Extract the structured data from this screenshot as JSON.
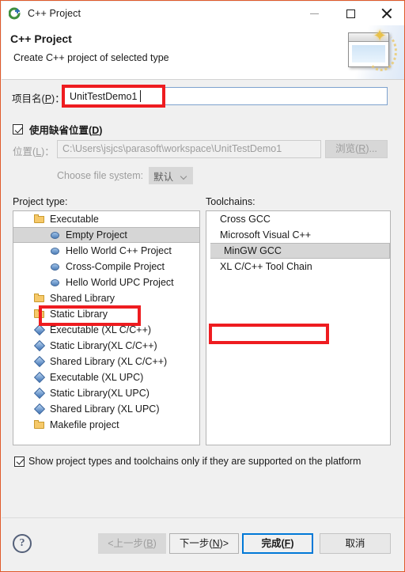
{
  "window": {
    "title": "C++ Project",
    "icon": "cpp-project-icon",
    "minimize_label": "—",
    "maximize_label": "□",
    "close_label": "✕"
  },
  "header": {
    "title": "C++ Project",
    "subtitle": "Create C++ project of selected type",
    "banner_icon": "wizard-window-sparkle-icon",
    "sparkle_glyph": "✦"
  },
  "form": {
    "project_name_label": "项目名(P)：",
    "project_name_label_plain": "项目名",
    "project_name_mnemonic": "P",
    "project_name_value": "UnitTestDemo1",
    "use_default_location_label": "使用缺省位置(D)",
    "use_default_location_plain": "使用缺省位置",
    "use_default_location_mnemonic": "D",
    "use_default_location_checked": true,
    "location_label_plain": "位置",
    "location_mnemonic": "L",
    "location_label": "位置(L)：",
    "location_value": "C:\\Users\\jsjcs\\parasoft\\workspace\\UnitTestDemo1",
    "browse_button": "浏览(R)...",
    "browse_plain": "浏览",
    "browse_mnemonic": "R",
    "choose_fs_label": "Choose file s",
    "choose_fs_mnemonic": "y",
    "choose_fs_label_tail": "stem:",
    "choose_fs_value": "默认"
  },
  "project_type": {
    "label": "Project type:",
    "items": [
      {
        "text": "Executable",
        "icon": "folder-icon",
        "indent": 0,
        "selected": false
      },
      {
        "text": "Empty Project",
        "icon": "ball-icon",
        "indent": 1,
        "selected": true
      },
      {
        "text": "Hello World C++ Project",
        "icon": "ball-icon",
        "indent": 1,
        "selected": false
      },
      {
        "text": "Cross-Compile Project",
        "icon": "ball-icon",
        "indent": 1,
        "selected": false
      },
      {
        "text": "Hello World UPC Project",
        "icon": "ball-icon",
        "indent": 1,
        "selected": false
      },
      {
        "text": "Shared Library",
        "icon": "folder-icon",
        "indent": 0,
        "selected": false
      },
      {
        "text": "Static Library",
        "icon": "folder-icon",
        "indent": 0,
        "selected": false
      },
      {
        "text": "Executable (XL C/C++)",
        "icon": "diamond-icon",
        "indent": 0,
        "selected": false
      },
      {
        "text": "Static Library(XL C/C++)",
        "icon": "diamond-icon",
        "indent": 0,
        "selected": false
      },
      {
        "text": "Shared Library (XL C/C++)",
        "icon": "diamond-icon",
        "indent": 0,
        "selected": false
      },
      {
        "text": "Executable (XL UPC)",
        "icon": "diamond-icon",
        "indent": 0,
        "selected": false
      },
      {
        "text": "Static Library(XL UPC)",
        "icon": "diamond-icon",
        "indent": 0,
        "selected": false
      },
      {
        "text": "Shared Library (XL UPC)",
        "icon": "diamond-icon",
        "indent": 0,
        "selected": false
      },
      {
        "text": "Makefile project",
        "icon": "folder-icon",
        "indent": 0,
        "selected": false
      }
    ]
  },
  "toolchains": {
    "label": "Toolchains:",
    "items": [
      {
        "text": "Cross GCC",
        "selected": false
      },
      {
        "text": "Microsoft Visual C++",
        "selected": false
      },
      {
        "text": "MinGW GCC",
        "selected": true
      },
      {
        "text": "XL C/C++ Tool Chain",
        "selected": false
      }
    ]
  },
  "options": {
    "show_supported_label": "Show project types and toolchains only if they are supported on the platform",
    "show_supported_checked": true
  },
  "footer": {
    "help_glyph": "?",
    "back_button": "<上一步(B)",
    "back_plain_pre": "<上一步(",
    "back_mnemonic": "B",
    "next_button": "下一步(N)>",
    "next_plain_pre": "下一步(",
    "next_mnemonic": "N",
    "finish_button": "完成(F)",
    "finish_plain_pre": "完成(",
    "finish_mnemonic": "F",
    "cancel_button": "取消"
  },
  "annotations": {
    "color": "#ee1c20",
    "boxes": [
      "project-name-field",
      "empty-project-item",
      "mingw-gcc-item"
    ]
  },
  "colors": {
    "window_border": "#e05a2b",
    "dialog_bg": "#f0f0f0",
    "accent_focus": "#0078d7",
    "selection_bg": "#d6d6d6",
    "annotation_red": "#ee1c20"
  }
}
